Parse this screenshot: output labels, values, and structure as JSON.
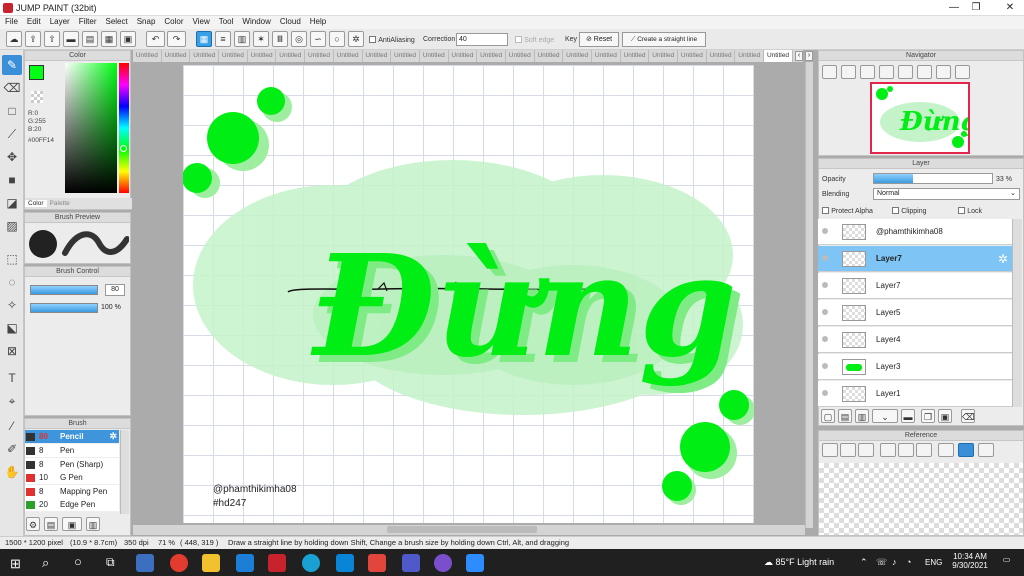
{
  "window": {
    "title": "JUMP PAINT (32bit)",
    "min": "—",
    "max": "❐",
    "close": "✕"
  },
  "menu": [
    "File",
    "Edit",
    "Layer",
    "Filter",
    "Select",
    "Snap",
    "Color",
    "View",
    "Tool",
    "Window",
    "Cloud",
    "Help"
  ],
  "toolbar": {
    "antialias": "AntiAliasing",
    "correction_label": "Correction",
    "correction_value": "40",
    "soft_edge": "Soft edge",
    "key": "Key",
    "reset": "Reset",
    "straight_line": "Create a straight line"
  },
  "tabs": [
    "Untitled",
    "Untitled",
    "Untitled",
    "Untitled",
    "Untitled",
    "Untitled",
    "Untitled",
    "Untitled",
    "Untitled",
    "Untitled",
    "Untitled",
    "Untitled",
    "Untitled",
    "Untitled",
    "Untitled",
    "Untitled",
    "Untitled",
    "Untitled",
    "Untitled",
    "Untitled",
    "Untitled",
    "Untitled",
    "Untitled"
  ],
  "color_panel": {
    "title": "Color",
    "values": [
      "R:0",
      "G:255",
      "B:20"
    ],
    "hex": "#00FF14",
    "tabs": [
      "Color",
      "Palette"
    ],
    "current": "#00ff14"
  },
  "brush_preview": {
    "title": "Brush Preview"
  },
  "brush_control": {
    "title": "Brush Control",
    "size": "80",
    "opacity": "100 %"
  },
  "brush_list": {
    "title": "Brush",
    "items": [
      {
        "size": "80",
        "name": "Pencil",
        "color": "#333333"
      },
      {
        "size": "8",
        "name": "Pen",
        "color": "#333333"
      },
      {
        "size": "8",
        "name": "Pen (Sharp)",
        "color": "#333333"
      },
      {
        "size": "10",
        "name": "G Pen",
        "color": "#e03030"
      },
      {
        "size": "8",
        "name": "Mapping Pen",
        "color": "#e03030"
      },
      {
        "size": "20",
        "name": "Edge Pen",
        "color": "#2ca02c"
      }
    ]
  },
  "navigator": {
    "title": "Navigator"
  },
  "layer_panel": {
    "title": "Layer",
    "opacity_label": "Opacity",
    "opacity_value": "33 %",
    "opacity_fraction": 0.33,
    "blending_label": "Blending",
    "blending_value": "Normal",
    "protect_alpha": "Protect Alpha",
    "clipping": "Clipping",
    "lock": "Lock",
    "layers": [
      "@phamthikimha08",
      "Layer7",
      "Layer7",
      "Layer5",
      "Layer4",
      "Layer3",
      "Layer1"
    ],
    "selected_index": 1
  },
  "reference": {
    "title": "Reference"
  },
  "canvas_text": {
    "lettering": "Đừng",
    "credit": "@phamthikimha08",
    "tag": "#hd247"
  },
  "status": {
    "size": "1500 * 1200 pixel",
    "phys": "(10.9 * 8.7cm)",
    "dpi": "350 dpi",
    "zoom": "71 %",
    "coords": "( 448, 319 )",
    "hint": "Draw a straight line by holding down Shift, Change a brush size by holding down Ctrl, Alt, and dragging"
  },
  "taskbar": {
    "weather": "85°F  Light rain",
    "lang": "ENG",
    "time": "10:34 AM",
    "date": "9/30/2021"
  }
}
